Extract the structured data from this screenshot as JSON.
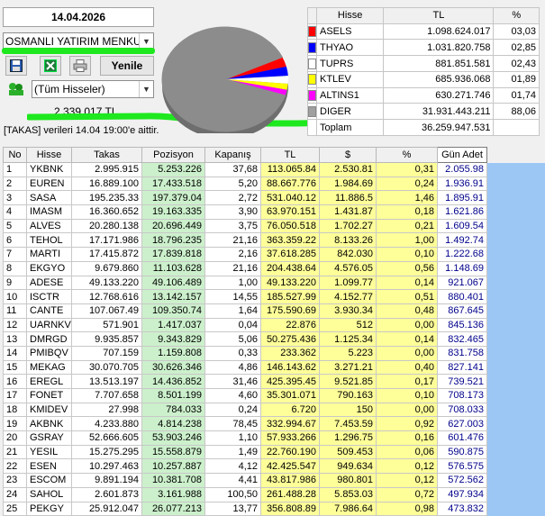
{
  "header": {
    "date": "14.04.2026",
    "institution": "OSMANLI YATIRIM MENKUL",
    "filter": "(Tüm Hisseler)",
    "refresh_label": "Yenile",
    "total_value": "2.339.017 TL",
    "takas_note": "[TAKAS] verileri 14.04 19:00'e aittir."
  },
  "toolbar": {
    "save_icon": "floppy-disk-icon",
    "excel_icon": "excel-icon",
    "print_icon": "printer-icon",
    "group_icon": "green-group-icon"
  },
  "colors": {
    "pie_slices": [
      "#ff0000",
      "#0000ff",
      "#ffffff",
      "#ffff00",
      "#ff00ff",
      "#a0a0a0"
    ],
    "green_highlight": "#1ee81e",
    "pozisyon_bg": "#ccf0cc",
    "tl_bg": "#ffff99",
    "gun_adet_color": "#00008b"
  },
  "legend": {
    "headers": [
      "Hisse",
      "TL",
      "%"
    ],
    "rows": [
      {
        "color": "#ff0000",
        "name": "ASELS",
        "tl": "1.098.624.017",
        "pct": "03,03"
      },
      {
        "color": "#0000ff",
        "name": "THYAO",
        "tl": "1.031.820.758",
        "pct": "02,85"
      },
      {
        "color": "#ffffff",
        "name": "TUPRS",
        "tl": "881.851.581",
        "pct": "02,43"
      },
      {
        "color": "#ffff00",
        "name": "KTLEV",
        "tl": "685.936.068",
        "pct": "01,89"
      },
      {
        "color": "#ff00ff",
        "name": "ALTINS1",
        "tl": "630.271.746",
        "pct": "01,74"
      },
      {
        "color": "#a0a0a0",
        "name": "DIGER",
        "tl": "31.931.443.211",
        "pct": "88,06"
      }
    ],
    "total_label": "Toplam",
    "total_tl": "36.259.947.531"
  },
  "chart_data": {
    "type": "pie",
    "categories": [
      "ASELS",
      "THYAO",
      "TUPRS",
      "KTLEV",
      "ALTINS1",
      "DIGER"
    ],
    "values": [
      3.03,
      2.85,
      2.43,
      1.89,
      1.74,
      88.06
    ]
  },
  "table": {
    "headers": [
      "No",
      "Hisse",
      "Takas",
      "Pozisyon",
      "Kapanış",
      "TL",
      "$",
      "%",
      "Gün Adet"
    ],
    "rows": [
      [
        "1",
        "YKBNK",
        "2.995.915",
        "5.253.226",
        "37,68",
        "113.065.84",
        "2.530.81",
        "0,31",
        "2.055.98"
      ],
      [
        "2",
        "EUREN",
        "16.889.100",
        "17.433.518",
        "5,20",
        "88.667.776",
        "1.984.69",
        "0,24",
        "1.936.91"
      ],
      [
        "3",
        "SASA",
        "195.235.33",
        "197.379.04",
        "2,72",
        "531.040.12",
        "11.886.5",
        "1,46",
        "1.895.91"
      ],
      [
        "4",
        "IMASM",
        "16.360.652",
        "19.163.335",
        "3,90",
        "63.970.151",
        "1.431.87",
        "0,18",
        "1.621.86"
      ],
      [
        "5",
        "ALVES",
        "20.280.138",
        "20.696.449",
        "3,75",
        "76.050.518",
        "1.702.27",
        "0,21",
        "1.609.54"
      ],
      [
        "6",
        "TEHOL",
        "17.171.986",
        "18.796.235",
        "21,16",
        "363.359.22",
        "8.133.26",
        "1,00",
        "1.492.74"
      ],
      [
        "7",
        "MARTI",
        "17.415.872",
        "17.839.818",
        "2,16",
        "37.618.285",
        "842.030",
        "0,10",
        "1.222.68"
      ],
      [
        "8",
        "EKGYO",
        "9.679.860",
        "11.103.628",
        "21,16",
        "204.438.64",
        "4.576.05",
        "0,56",
        "1.148.69"
      ],
      [
        "9",
        "ADESE",
        "49.133.220",
        "49.106.489",
        "1,00",
        "49.133.220",
        "1.099.77",
        "0,14",
        "921.067"
      ],
      [
        "10",
        "ISCTR",
        "12.768.616",
        "13.142.157",
        "14,55",
        "185.527.99",
        "4.152.77",
        "0,51",
        "880.401"
      ],
      [
        "11",
        "CANTE",
        "107.067.49",
        "109.350.74",
        "1,64",
        "175.590.69",
        "3.930.34",
        "0,48",
        "867.645"
      ],
      [
        "12",
        "UARNKV",
        "571.901",
        "1.417.037",
        "0,04",
        "22.876",
        "512",
        "0,00",
        "845.136"
      ],
      [
        "13",
        "DMRGD",
        "9.935.857",
        "9.343.829",
        "5,06",
        "50.275.436",
        "1.125.34",
        "0,14",
        "832.465"
      ],
      [
        "14",
        "PMIBQV",
        "707.159",
        "1.159.808",
        "0,33",
        "233.362",
        "5.223",
        "0,00",
        "831.758"
      ],
      [
        "15",
        "MEKAG",
        "30.070.705",
        "30.626.346",
        "4,86",
        "146.143.62",
        "3.271.21",
        "0,40",
        "827.141"
      ],
      [
        "16",
        "EREGL",
        "13.513.197",
        "14.436.852",
        "31,46",
        "425.395.45",
        "9.521.85",
        "0,17",
        "739.521"
      ],
      [
        "17",
        "FONET",
        "7.707.658",
        "8.501.199",
        "4,60",
        "35.301.071",
        "790.163",
        "0,10",
        "708.173"
      ],
      [
        "18",
        "KMIDEV",
        "27.998",
        "784.033",
        "0,24",
        "6.720",
        "150",
        "0,00",
        "708.033"
      ],
      [
        "19",
        "AKBNK",
        "4.233.880",
        "4.814.238",
        "78,45",
        "332.994.67",
        "7.453.59",
        "0,92",
        "627.003"
      ],
      [
        "20",
        "GSRAY",
        "52.666.605",
        "53.903.246",
        "1,10",
        "57.933.266",
        "1.296.75",
        "0,16",
        "601.476"
      ],
      [
        "21",
        "YESIL",
        "15.275.295",
        "15.558.879",
        "1,49",
        "22.760.190",
        "509.453",
        "0,06",
        "590.875"
      ],
      [
        "22",
        "ESEN",
        "10.297.463",
        "10.257.887",
        "4,12",
        "42.425.547",
        "949.634",
        "0,12",
        "576.575"
      ],
      [
        "23",
        "ESCOM",
        "9.891.194",
        "10.381.708",
        "4,41",
        "43.817.986",
        "980.801",
        "0,12",
        "572.562"
      ],
      [
        "24",
        "SAHOL",
        "2.601.873",
        "3.161.988",
        "100,50",
        "261.488.28",
        "5.853.03",
        "0,72",
        "497.934"
      ],
      [
        "25",
        "PEKGY",
        "25.912.047",
        "26.077.213",
        "13,77",
        "356.808.89",
        "7.986.64",
        "0,98",
        "473.832"
      ]
    ]
  }
}
